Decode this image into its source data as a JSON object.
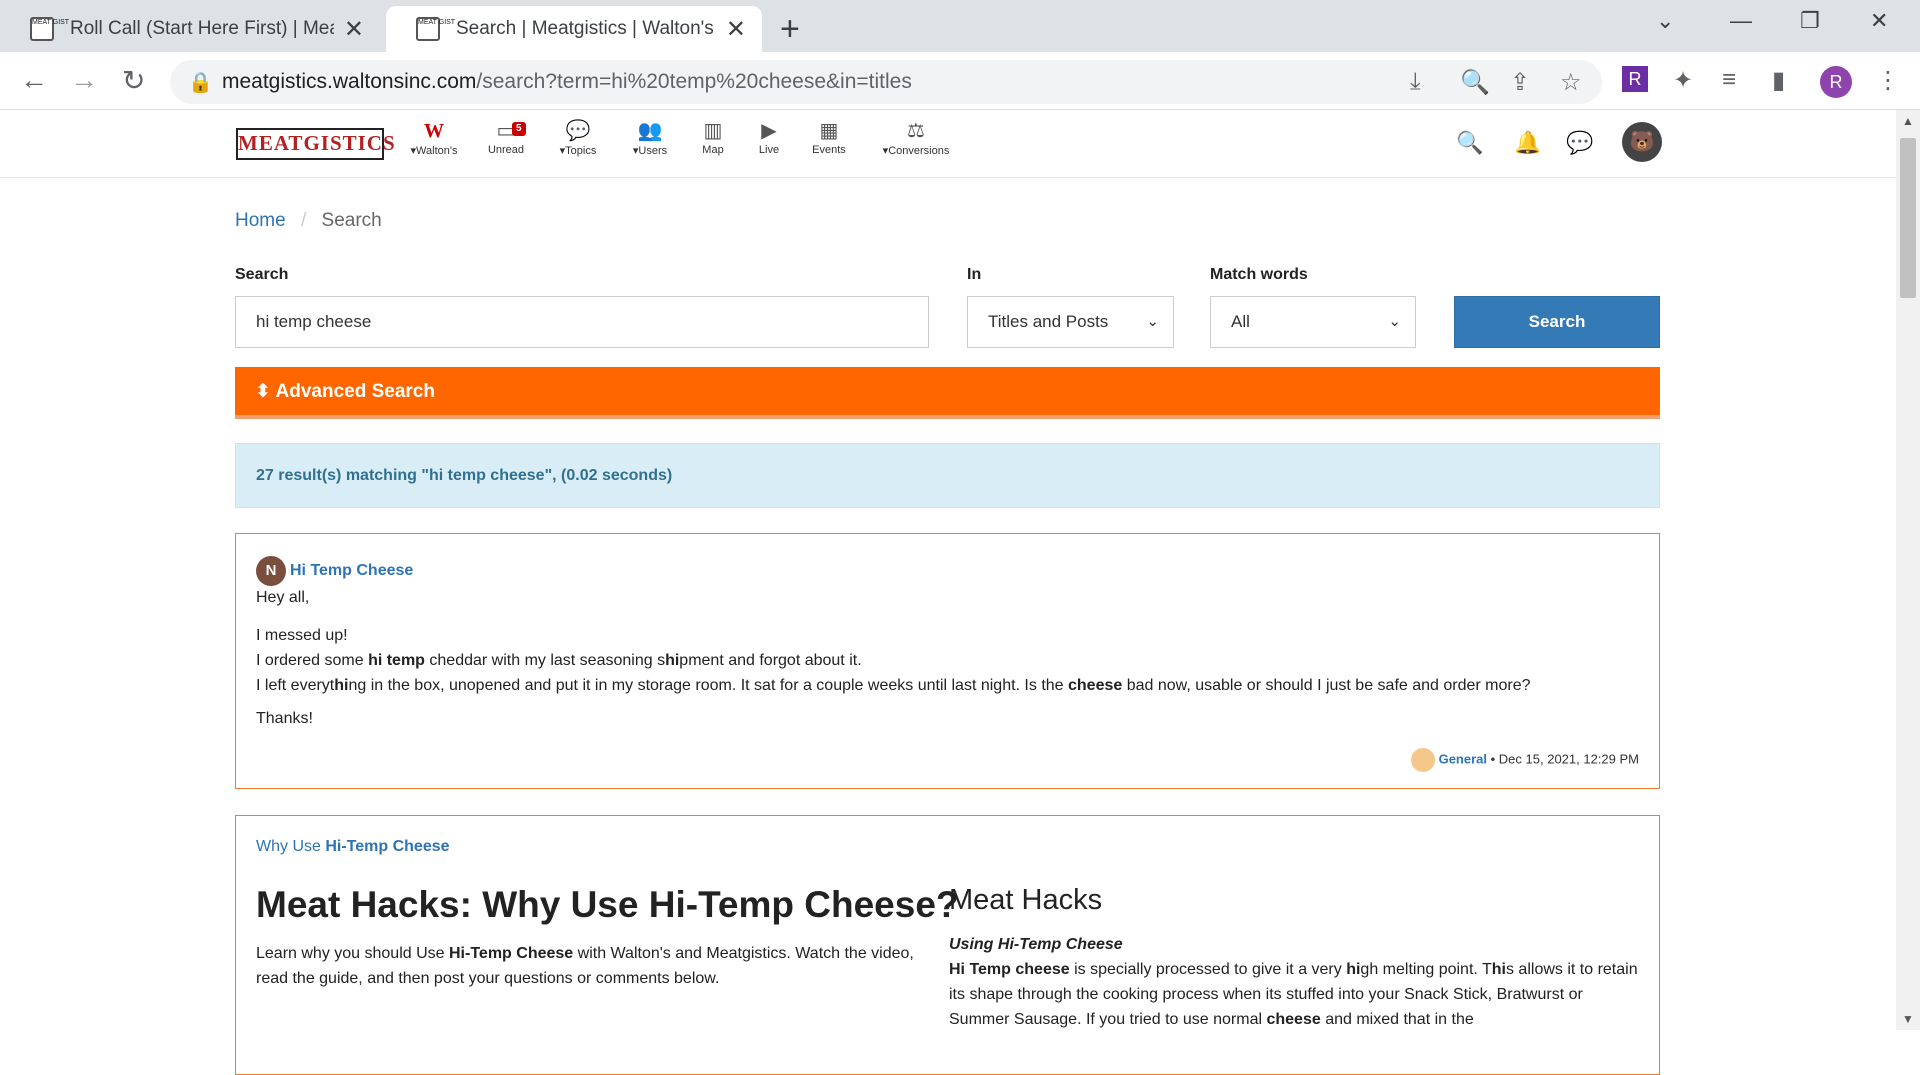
{
  "browser": {
    "tabs": [
      {
        "title": "Roll Call (Start Here First) | Meatg",
        "favicon": "MEAT GIST"
      },
      {
        "title": "Search | Meatgistics | Walton's",
        "favicon": "MEAT GIST"
      }
    ],
    "new_tab": "+",
    "url_domain": "meatgistics.waltonsinc.com",
    "url_path": "/search?term=hi%20temp%20cheese&in=titles",
    "profile_initial": "R"
  },
  "site": {
    "logo": "MEATGISTICS",
    "nav": [
      {
        "label": "Walton's",
        "icon": "W",
        "caret": true
      },
      {
        "label": "Unread",
        "icon": "inbox-icon",
        "badge": "5"
      },
      {
        "label": "Topics",
        "icon": "comments-icon",
        "caret": true
      },
      {
        "label": "Users",
        "icon": "users-icon",
        "caret": true
      },
      {
        "label": "Map",
        "icon": "map-icon"
      },
      {
        "label": "Live",
        "icon": "youtube-icon"
      },
      {
        "label": "Events",
        "icon": "calendar-icon"
      },
      {
        "label": "Conversions",
        "icon": "scale-icon",
        "caret": true
      }
    ]
  },
  "breadcrumb": {
    "home": "Home",
    "sep": "/",
    "current": "Search"
  },
  "search": {
    "label": "Search",
    "value": "hi temp cheese",
    "in_label": "In",
    "in_value": "Titles and Posts",
    "match_label": "Match words",
    "match_value": "All",
    "button": "Search"
  },
  "advanced": "Advanced Search",
  "results_info": "27 result(s) matching \"hi temp cheese\", (0.02 seconds)",
  "result1": {
    "avatar_letter": "N",
    "title": "Hi Temp Cheese",
    "category": "General",
    "date": "Dec 15, 2021, 12:29 PM"
  },
  "result2": {
    "title_plain": "Why Use ",
    "title_bold": "Hi-Temp Cheese",
    "heading": "Meat Hacks: Why Use Hi-Temp Cheese?",
    "side_heading": "Meat Hacks",
    "side_subheading": "Using Hi-Temp Cheese"
  },
  "colors": {
    "accent": "#ff6600",
    "link": "#2e74b5",
    "button": "#337ab7",
    "info_bg": "#d9edf7"
  }
}
